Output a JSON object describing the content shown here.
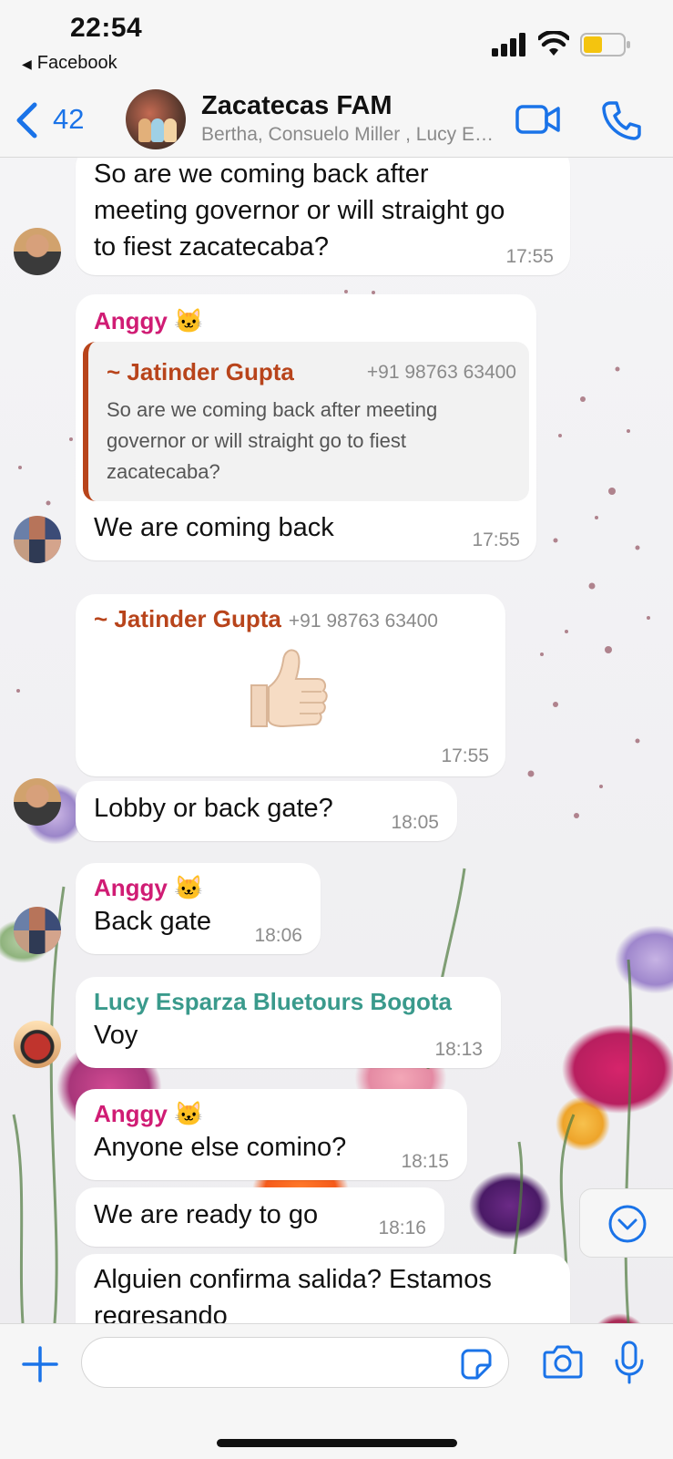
{
  "status_bar": {
    "time": "22:54",
    "back_app_label": "Facebook"
  },
  "header": {
    "unread_count": "42",
    "title": "Zacatecas FAM",
    "members": "Bertha, Consuelo Miller , Lucy Esparza Bluetours Bogota",
    "accent_color": "#1a73e8"
  },
  "messages": [
    {
      "text": "So are we coming back after meeting governor or will straight go to fiest zacatecaba?",
      "time": "17:55"
    },
    {
      "sender": "Anggy 🐱",
      "quote": {
        "name": "~ Jatinder Gupta",
        "phone": "+91 98763 63400",
        "text": "So are we coming back after meeting governor or will straight go to fiest zacatecaba?"
      },
      "text": "We are coming back",
      "time": "17:55"
    },
    {
      "sender": "~ Jatinder Gupta",
      "phone": "+91 98763 63400",
      "sticker": "thumbs-up",
      "time": "17:55"
    },
    {
      "text": "Lobby or back gate?",
      "time": "18:05"
    },
    {
      "sender": "Anggy 🐱",
      "text": "Back gate",
      "time": "18:06"
    },
    {
      "sender": "Lucy Esparza  Bluetours Bogota",
      "text": "Voy",
      "time": "18:13"
    },
    {
      "sender": "Anggy 🐱",
      "text": "Anyone else comino?",
      "time": "18:15"
    },
    {
      "text": "We are ready  to go",
      "time": "18:16"
    },
    {
      "text": "Alguien confirma salida? Estamos regresando"
    }
  ],
  "composer": {
    "placeholder": ""
  },
  "colors": {
    "sender_anggy": "#d01c74",
    "sender_jatinder": "#b8441b",
    "sender_lucy": "#3a9a8c"
  }
}
